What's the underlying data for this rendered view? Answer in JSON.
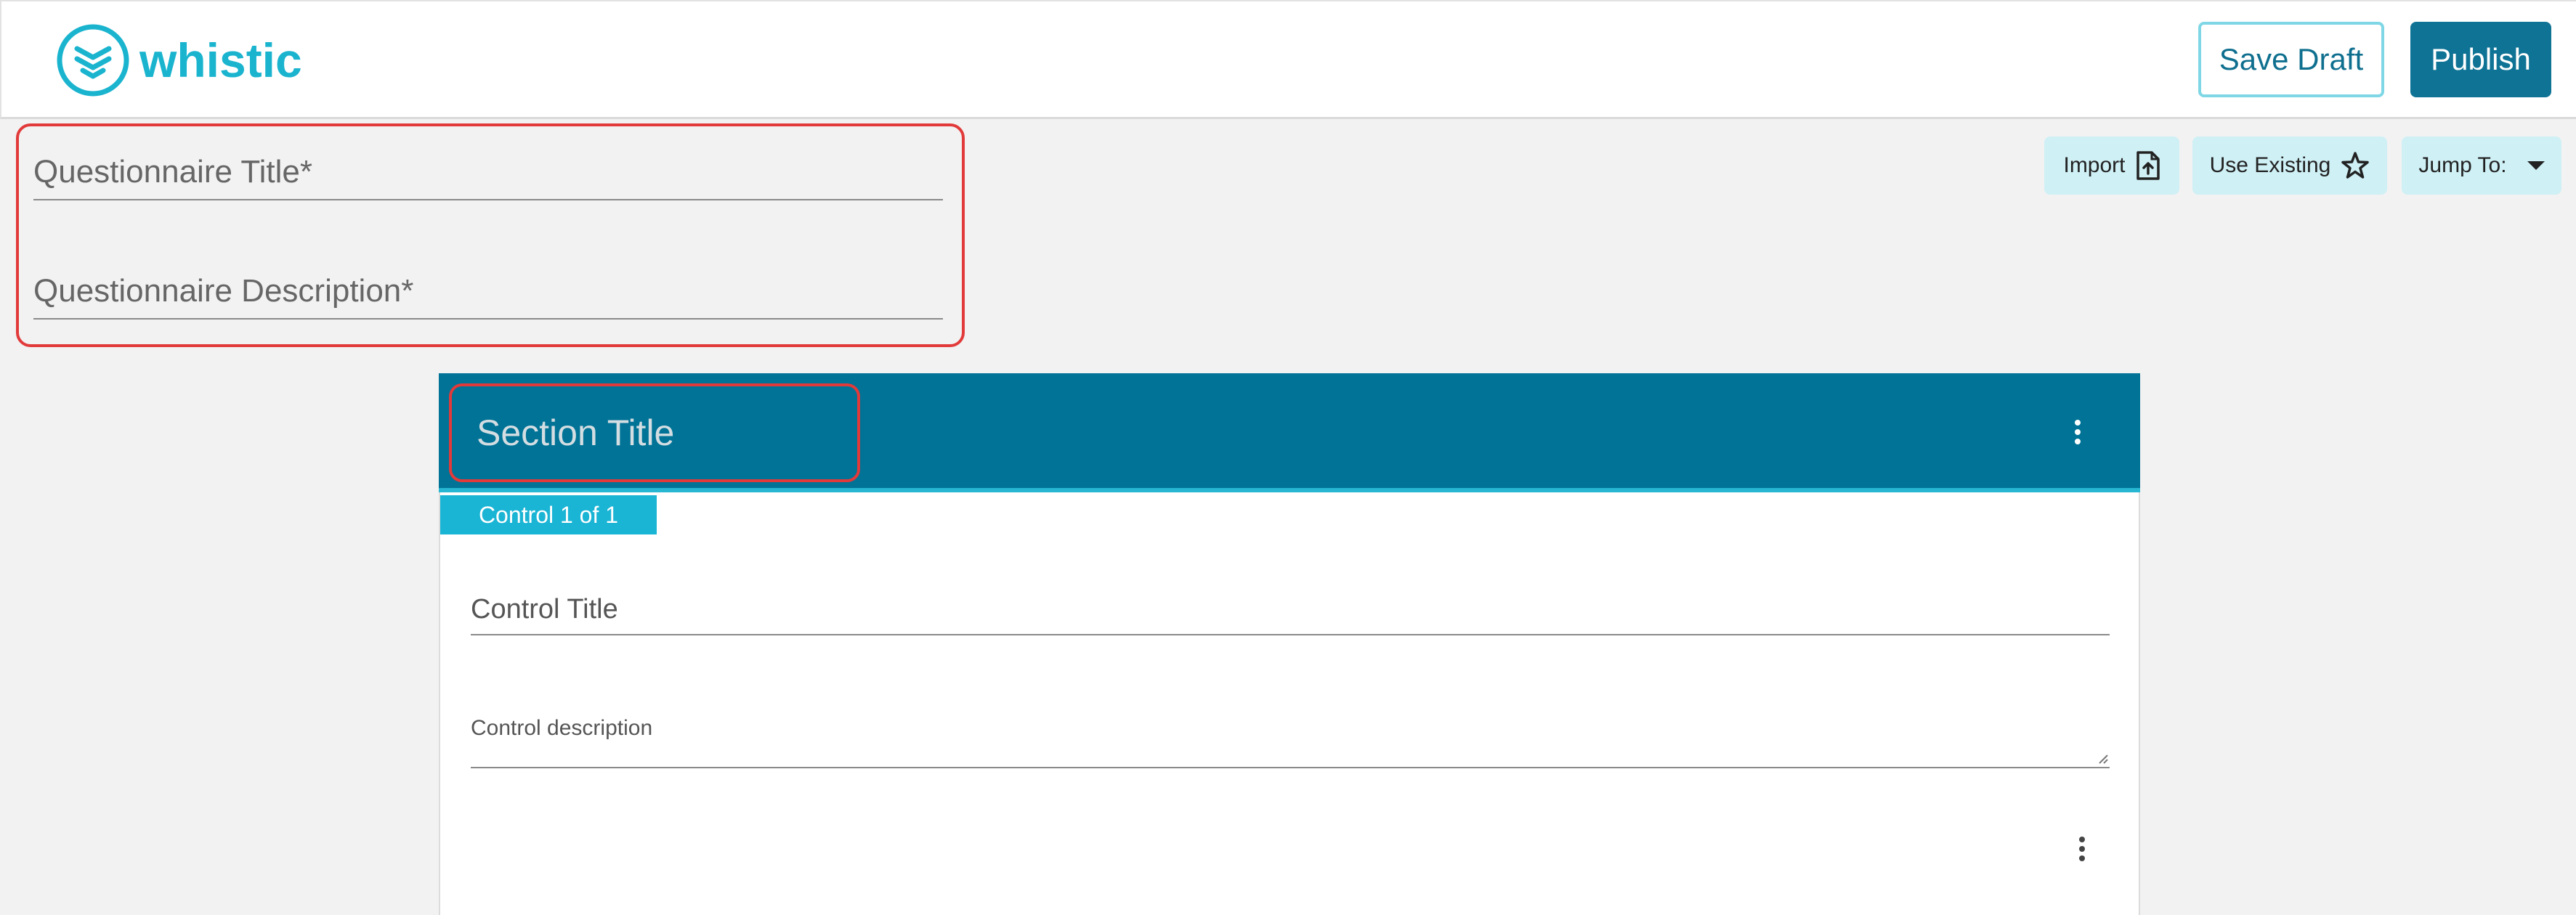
{
  "brand": {
    "name": "whistic",
    "accent": "#1ab4cf"
  },
  "header": {
    "save_draft_label": "Save Draft",
    "publish_label": "Publish"
  },
  "questionnaire": {
    "title_placeholder": "Questionnaire Title*",
    "description_placeholder": "Questionnaire Description*"
  },
  "toolbar": {
    "import_label": "Import",
    "import_icon": "file-upload-icon",
    "use_existing_label": "Use Existing",
    "use_existing_icon": "star-icon",
    "jump_to_label": "Jump To:",
    "jump_to_icon": "caret-down-icon"
  },
  "section": {
    "title": "Section Title",
    "menu_icon": "more-vertical-icon",
    "header_color": "#007396",
    "control_counter": "Control 1 of 1",
    "control": {
      "title_placeholder": "Control Title",
      "description_placeholder": "Control description",
      "menu_icon": "more-vertical-icon"
    }
  },
  "highlight_color": "#e23a3a"
}
